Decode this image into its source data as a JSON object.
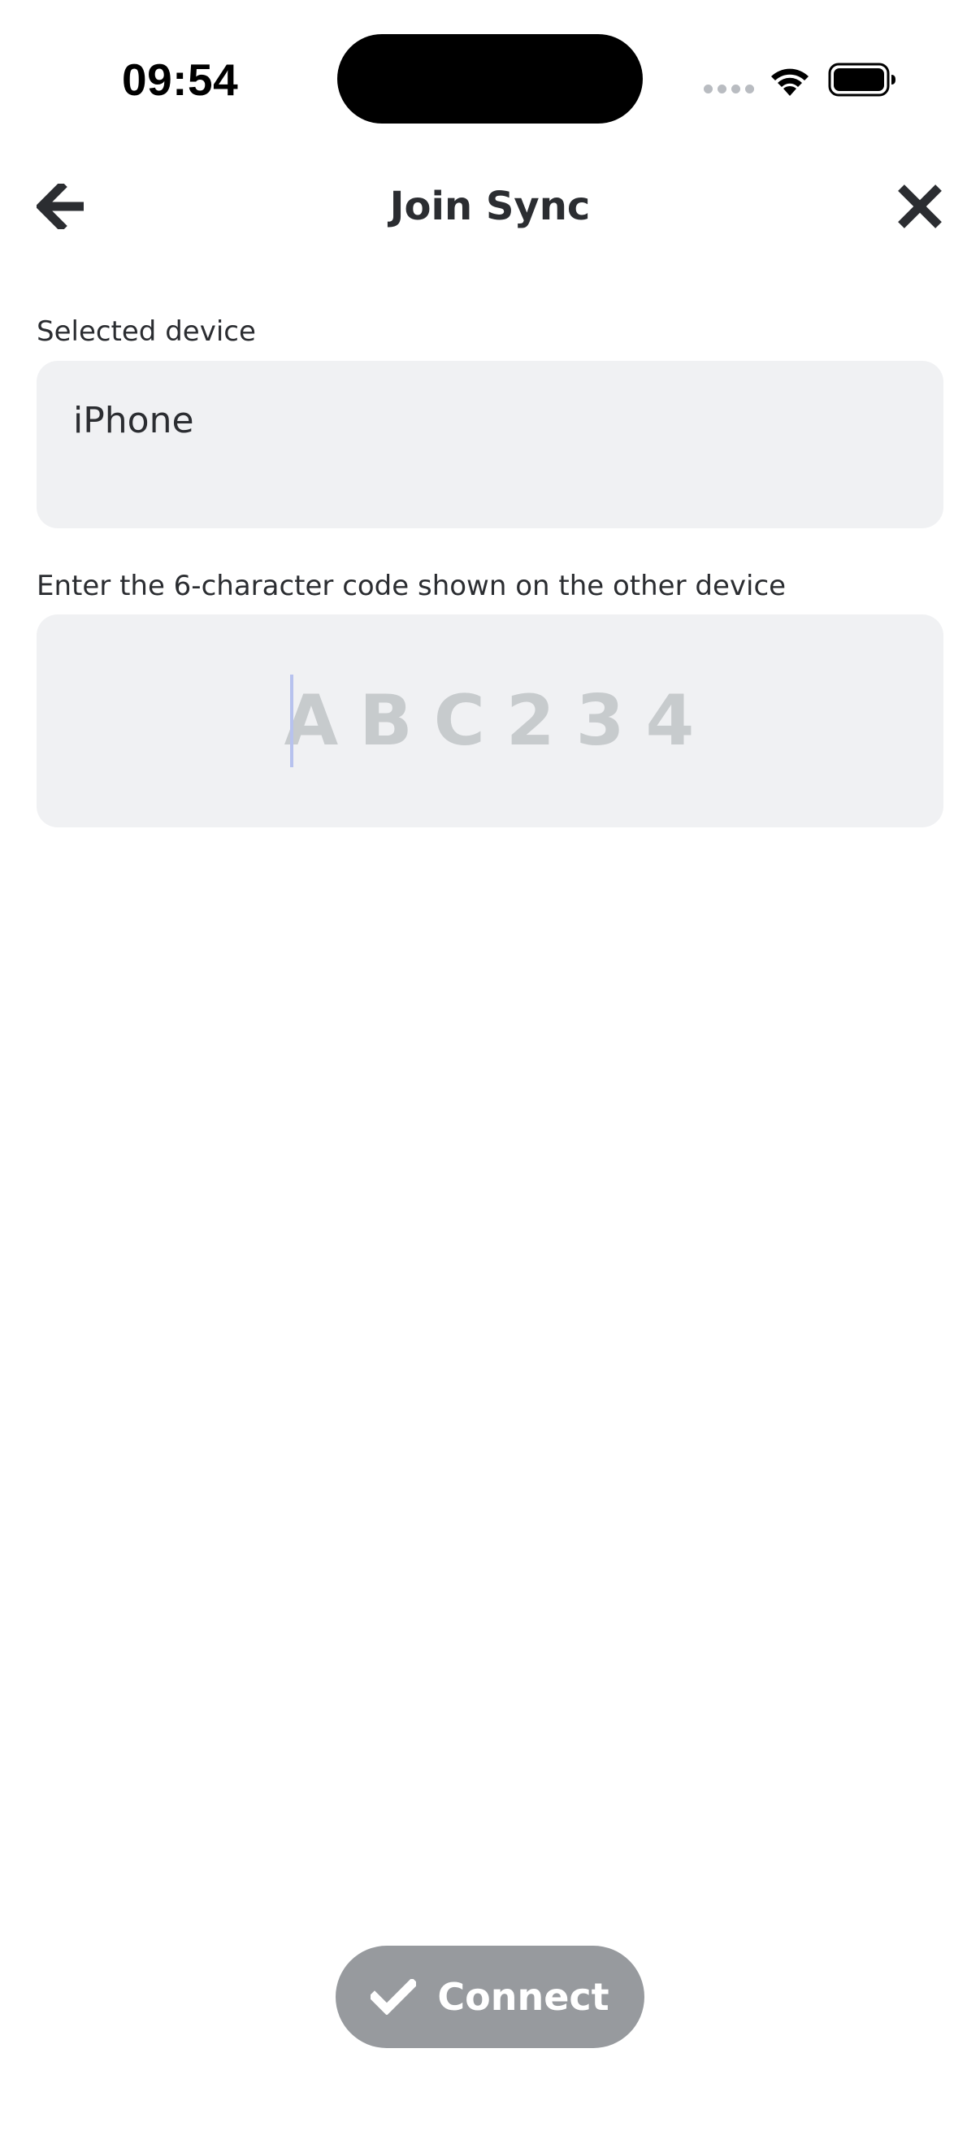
{
  "status_bar": {
    "time": "09:54"
  },
  "header": {
    "title": "Join Sync",
    "back_icon": "arrow-left-icon",
    "close_icon": "close-icon"
  },
  "form": {
    "device_label": "Selected device",
    "device_value": "iPhone",
    "code_label": "Enter the 6-character code shown on the other device",
    "code_value": "",
    "code_placeholder": "ABC234"
  },
  "actions": {
    "connect_label": "Connect",
    "connect_icon": "checkmark-icon",
    "connect_color": "#979a9e"
  },
  "colors": {
    "text": "#2b2d31",
    "field_background": "#f0f1f3",
    "placeholder": "#c7cbcd",
    "cursor": "#b7c2ee"
  }
}
